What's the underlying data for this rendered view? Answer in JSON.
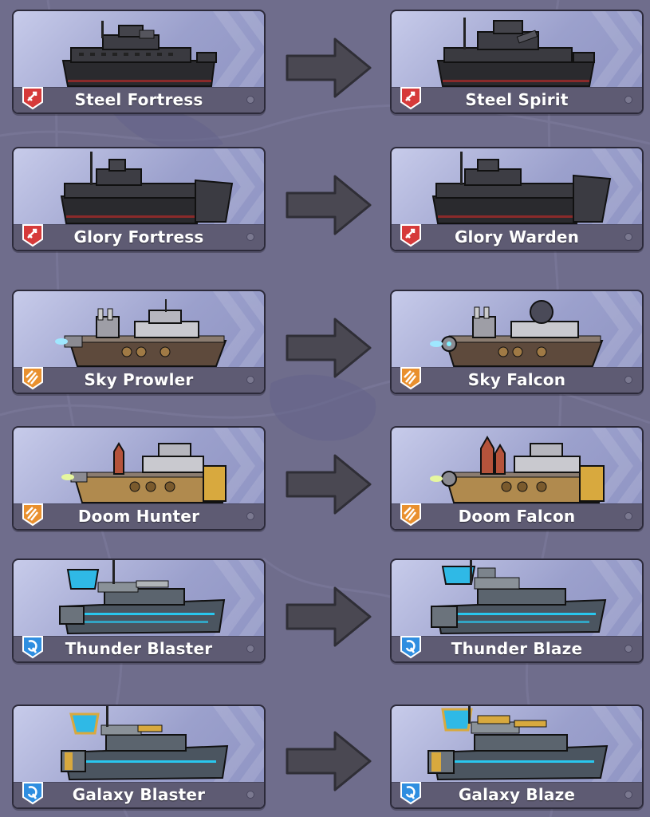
{
  "colors": {
    "background": "#6f6d8c",
    "arrow": "#4a4852",
    "namebar": "#5e5b73",
    "badge_red": "#d63a3a",
    "badge_orange": "#e9902e",
    "badge_blue": "#2f8ee0"
  },
  "upgrades": [
    {
      "from": {
        "name": "Steel Fortress",
        "class_icon": "attack-icon",
        "class_color": "red",
        "style": "dark"
      },
      "to": {
        "name": "Steel Spirit",
        "class_icon": "attack-icon",
        "class_color": "red",
        "style": "dark"
      }
    },
    {
      "from": {
        "name": "Glory Fortress",
        "class_icon": "attack-icon",
        "class_color": "red",
        "style": "dark"
      },
      "to": {
        "name": "Glory Warden",
        "class_icon": "attack-icon",
        "class_color": "red",
        "style": "dark"
      }
    },
    {
      "from": {
        "name": "Sky Prowler",
        "class_icon": "missile-icon",
        "class_color": "orange",
        "style": "brown"
      },
      "to": {
        "name": "Sky Falcon",
        "class_icon": "missile-icon",
        "class_color": "orange",
        "style": "brown"
      }
    },
    {
      "from": {
        "name": "Doom Hunter",
        "class_icon": "missile-icon",
        "class_color": "orange",
        "style": "gold"
      },
      "to": {
        "name": "Doom Falcon",
        "class_icon": "missile-icon",
        "class_color": "orange",
        "style": "gold"
      }
    },
    {
      "from": {
        "name": "Thunder Blaster",
        "class_icon": "tech-icon",
        "class_color": "blue",
        "style": "steel"
      },
      "to": {
        "name": "Thunder Blaze",
        "class_icon": "tech-icon",
        "class_color": "blue",
        "style": "steel"
      }
    },
    {
      "from": {
        "name": "Galaxy Blaster",
        "class_icon": "tech-icon",
        "class_color": "blue",
        "style": "steel-gold"
      },
      "to": {
        "name": "Galaxy Blaze",
        "class_icon": "tech-icon",
        "class_color": "blue",
        "style": "steel-gold"
      }
    }
  ]
}
